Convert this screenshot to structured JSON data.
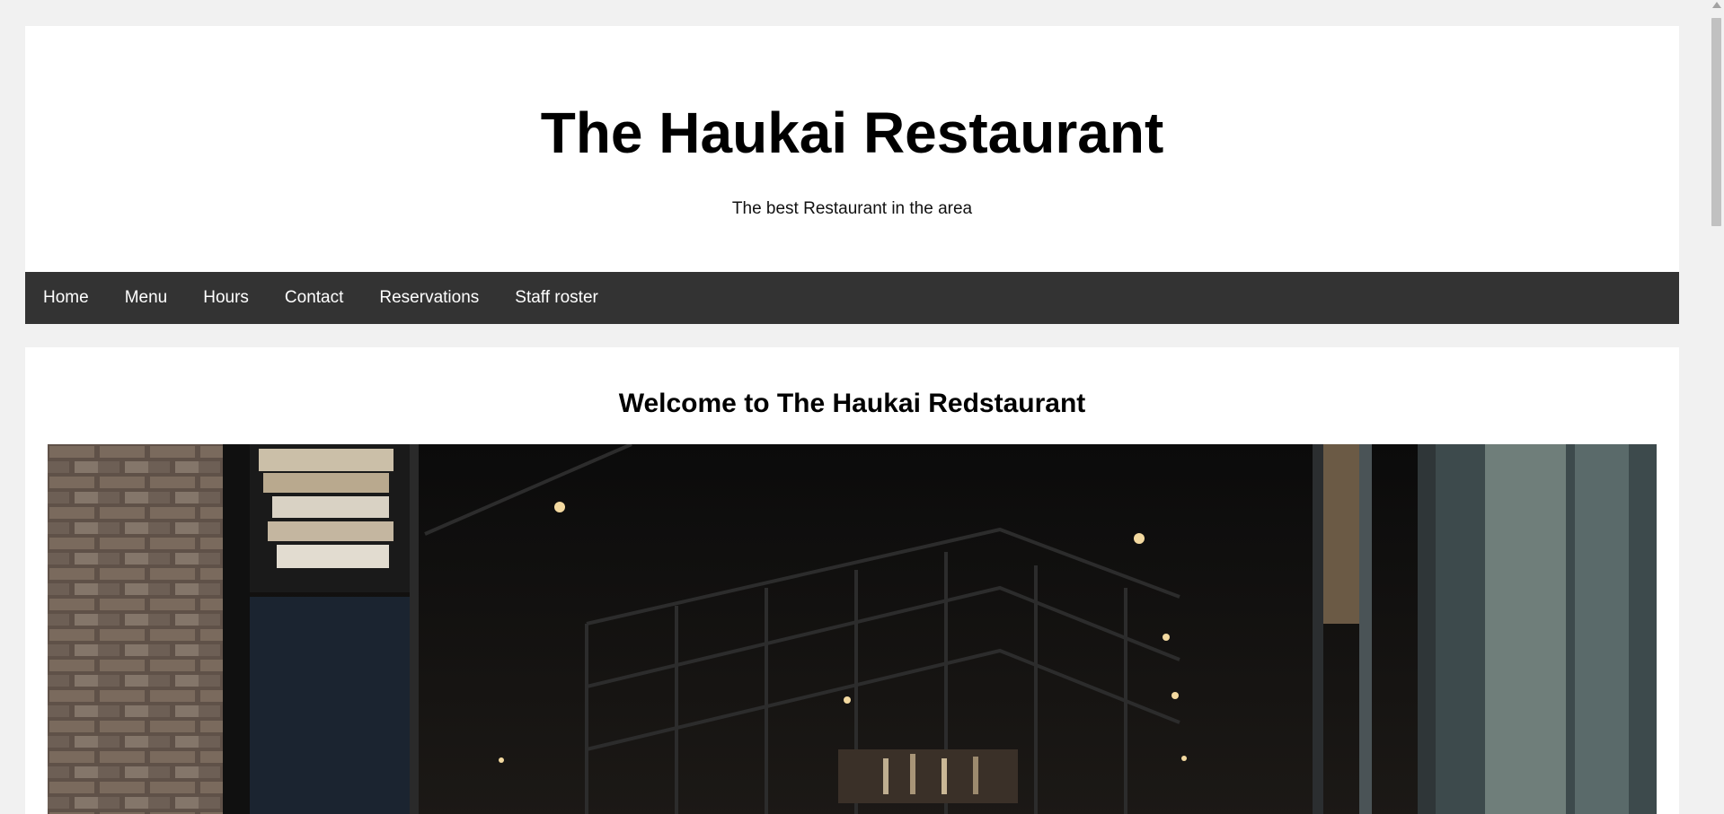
{
  "header": {
    "title": "The Haukai Restaurant",
    "tagline": "The best Restaurant in the area"
  },
  "nav": {
    "items": [
      {
        "label": "Home"
      },
      {
        "label": "Menu"
      },
      {
        "label": "Hours"
      },
      {
        "label": "Contact"
      },
      {
        "label": "Reservations"
      },
      {
        "label": "Staff roster"
      }
    ]
  },
  "main": {
    "heading": "Welcome to The Haukai Redstaurant",
    "hero_image_alt": "restaurant-interior-photo"
  },
  "colors": {
    "page_background": "#f1f1f1",
    "nav_background": "#333333",
    "nav_text": "#ffffff"
  }
}
